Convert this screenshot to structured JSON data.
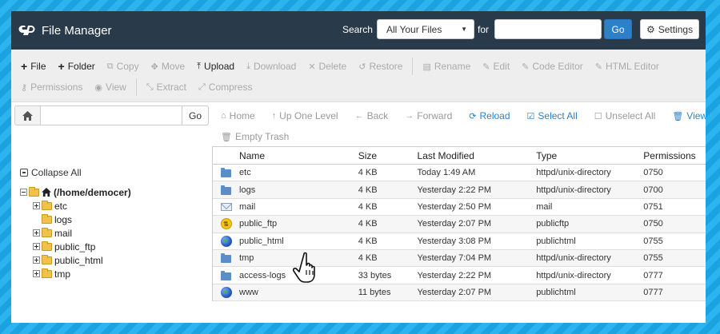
{
  "header": {
    "title": "File Manager",
    "search_label": "Search",
    "search_scope": "All Your Files",
    "for_label": "for",
    "search_value": "",
    "go_label": "Go",
    "settings_label": "Settings"
  },
  "toolbar": {
    "row1": [
      {
        "label": "File",
        "icon": "+",
        "name": "new-file-button",
        "active": true
      },
      {
        "label": "Folder",
        "icon": "+",
        "name": "new-folder-button",
        "active": true
      },
      {
        "label": "Copy",
        "icon": "⧉",
        "name": "copy-button",
        "active": false
      },
      {
        "label": "Move",
        "icon": "✥",
        "name": "move-button",
        "active": false
      },
      {
        "label": "Upload",
        "icon": "⤒",
        "name": "upload-button",
        "active": true
      },
      {
        "label": "Download",
        "icon": "⤓",
        "name": "download-button",
        "active": false
      },
      {
        "label": "Delete",
        "icon": "✕",
        "name": "delete-button",
        "active": false
      },
      {
        "label": "Restore",
        "icon": "↺",
        "name": "restore-button",
        "active": false
      },
      {
        "sep": true
      },
      {
        "label": "Rename",
        "icon": "▤",
        "name": "rename-button",
        "active": false
      },
      {
        "label": "Edit",
        "icon": "✎",
        "name": "edit-button",
        "active": false
      },
      {
        "label": "Code Editor",
        "icon": "✎",
        "name": "code-editor-button",
        "active": false
      },
      {
        "label": "HTML Editor",
        "icon": "✎",
        "name": "html-editor-button",
        "active": false
      }
    ],
    "row2": [
      {
        "label": "Permissions",
        "icon": "⚷",
        "name": "permissions-button",
        "active": false
      },
      {
        "label": "View",
        "icon": "◉",
        "name": "view-button",
        "active": false
      },
      {
        "sep": true
      },
      {
        "label": "Extract",
        "icon": "⤡",
        "name": "extract-button",
        "active": false
      },
      {
        "label": "Compress",
        "icon": "⤢",
        "name": "compress-button",
        "active": false
      }
    ]
  },
  "left": {
    "path_value": "",
    "go_label": "Go",
    "collapse_all": "Collapse All",
    "root_label": "(/home/democer)",
    "tree": [
      {
        "label": "etc",
        "expandable": true
      },
      {
        "label": "logs",
        "expandable": false
      },
      {
        "label": "mail",
        "expandable": true
      },
      {
        "label": "public_ftp",
        "expandable": true
      },
      {
        "label": "public_html",
        "expandable": true
      },
      {
        "label": "tmp",
        "expandable": true
      }
    ]
  },
  "nav": {
    "row1": [
      {
        "label": "Home",
        "icon": "⌂",
        "name": "nav-home-button",
        "blue": false
      },
      {
        "label": "Up One Level",
        "icon": "↑",
        "name": "up-one-level-button",
        "blue": false
      },
      {
        "label": "Back",
        "icon": "←",
        "name": "back-button",
        "blue": false
      },
      {
        "label": "Forward",
        "icon": "→",
        "name": "forward-button",
        "blue": false
      },
      {
        "label": "Reload",
        "icon": "⟳",
        "name": "reload-button",
        "blue": true
      },
      {
        "label": "Select All",
        "icon": "☑",
        "name": "select-all-button",
        "blue": true
      },
      {
        "label": "Unselect All",
        "icon": "☐",
        "name": "unselect-all-button",
        "blue": false
      },
      {
        "sep": true
      },
      {
        "label": "View Trash",
        "icon": "🗑",
        "name": "view-trash-button",
        "blue": true
      }
    ],
    "row2": [
      {
        "label": "Empty Trash",
        "icon": "🗑",
        "name": "empty-trash-button",
        "blue": false
      }
    ]
  },
  "table": {
    "headers": {
      "name": "Name",
      "size": "Size",
      "modified": "Last Modified",
      "type": "Type",
      "perms": "Permissions"
    },
    "rows": [
      {
        "icon": "folder",
        "name": "etc",
        "size": "4 KB",
        "modified": "Today 1:49 AM",
        "type": "httpd/unix-directory",
        "perms": "0750"
      },
      {
        "icon": "folder",
        "name": "logs",
        "size": "4 KB",
        "modified": "Yesterday 2:22 PM",
        "type": "httpd/unix-directory",
        "perms": "0700"
      },
      {
        "icon": "mail",
        "name": "mail",
        "size": "4 KB",
        "modified": "Yesterday 2:50 PM",
        "type": "mail",
        "perms": "0751"
      },
      {
        "icon": "ftp",
        "name": "public_ftp",
        "size": "4 KB",
        "modified": "Yesterday 2:07 PM",
        "type": "publicftp",
        "perms": "0750"
      },
      {
        "icon": "globe",
        "name": "public_html",
        "size": "4 KB",
        "modified": "Yesterday 3:08 PM",
        "type": "publichtml",
        "perms": "0755"
      },
      {
        "icon": "folder",
        "name": "tmp",
        "size": "4 KB",
        "modified": "Yesterday 7:04 PM",
        "type": "httpd/unix-directory",
        "perms": "0755"
      },
      {
        "icon": "folder",
        "name": "access-logs",
        "size": "33 bytes",
        "modified": "Yesterday 2:22 PM",
        "type": "httpd/unix-directory",
        "perms": "0777"
      },
      {
        "icon": "globe",
        "name": "www",
        "size": "11 bytes",
        "modified": "Yesterday 2:07 PM",
        "type": "publichtml",
        "perms": "0777"
      }
    ]
  },
  "colors": {
    "header_bg": "#293a4a",
    "accent": "#2d7fc8",
    "backdrop": "#1aa3e0"
  }
}
